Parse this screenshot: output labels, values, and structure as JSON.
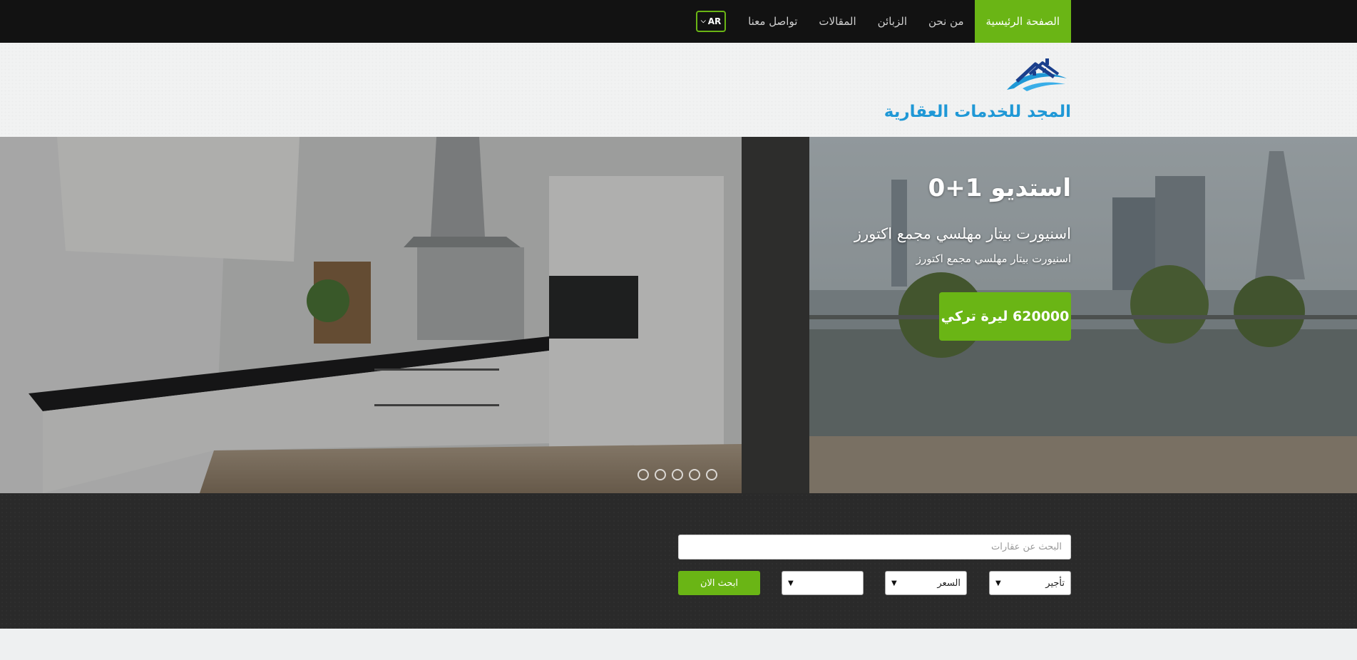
{
  "nav": {
    "items": [
      {
        "label": "الصفحة الرئيسية",
        "active": true
      },
      {
        "label": "من نحن",
        "active": false
      },
      {
        "label": "الزبائن",
        "active": false
      },
      {
        "label": "المقالات",
        "active": false
      },
      {
        "label": "تواصل معنا",
        "active": false
      }
    ],
    "language": "AR"
  },
  "header": {
    "brand": "المجد للخدمات العقارية",
    "logo_icon": "house-roof-logo-icon"
  },
  "hero": {
    "title": "استديو 1+0",
    "subtitle": "اسنيورت بيتار مهلسي مجمع اكتورز",
    "description": "اسنيورت بيتار مهلسي مجمع اكتورز",
    "price": "620000 ليرة تركي",
    "slide_count": 5
  },
  "search": {
    "placeholder": "البحث عن عقارات",
    "type_select": "تأجير",
    "price_select": "السعر",
    "extra_select": "",
    "button": "ابحث الان"
  },
  "colors": {
    "accent": "#6ab515",
    "brand": "#1f98d6",
    "nav_bg": "#121212",
    "search_bg": "#2a2a2a"
  }
}
